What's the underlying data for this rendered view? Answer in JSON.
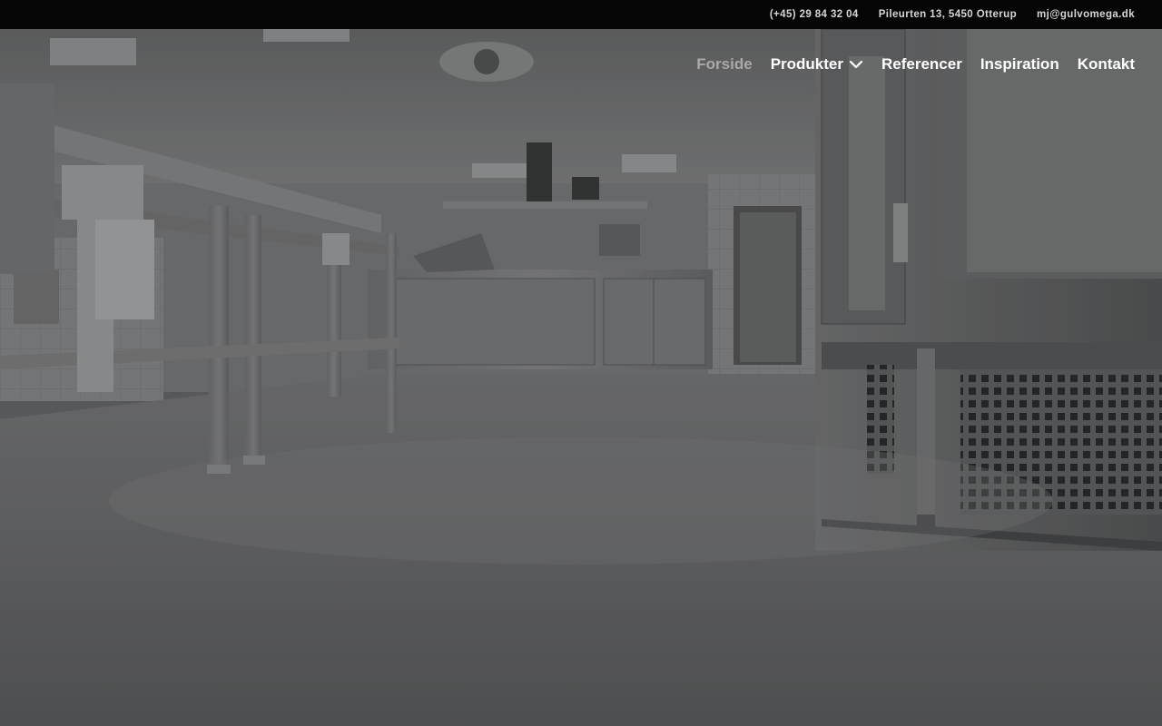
{
  "topbar": {
    "phone": "(+45) 29 84 32 04",
    "address": "Pileurten 13, 5450 Otterup",
    "email": "mj@gulvomega.dk"
  },
  "nav": {
    "items": [
      {
        "label": "Forside",
        "active": true
      },
      {
        "label": "Produkter",
        "has_dropdown": true
      },
      {
        "label": "Referencer"
      },
      {
        "label": "Inspiration"
      },
      {
        "label": "Kontakt"
      }
    ]
  },
  "colors": {
    "topbar_bg": "#050505",
    "nav_text": "#ffffff",
    "nav_active": "#a9a9ab"
  },
  "hero": {
    "image_subject": "industrial-kitchen-floor-photo"
  }
}
